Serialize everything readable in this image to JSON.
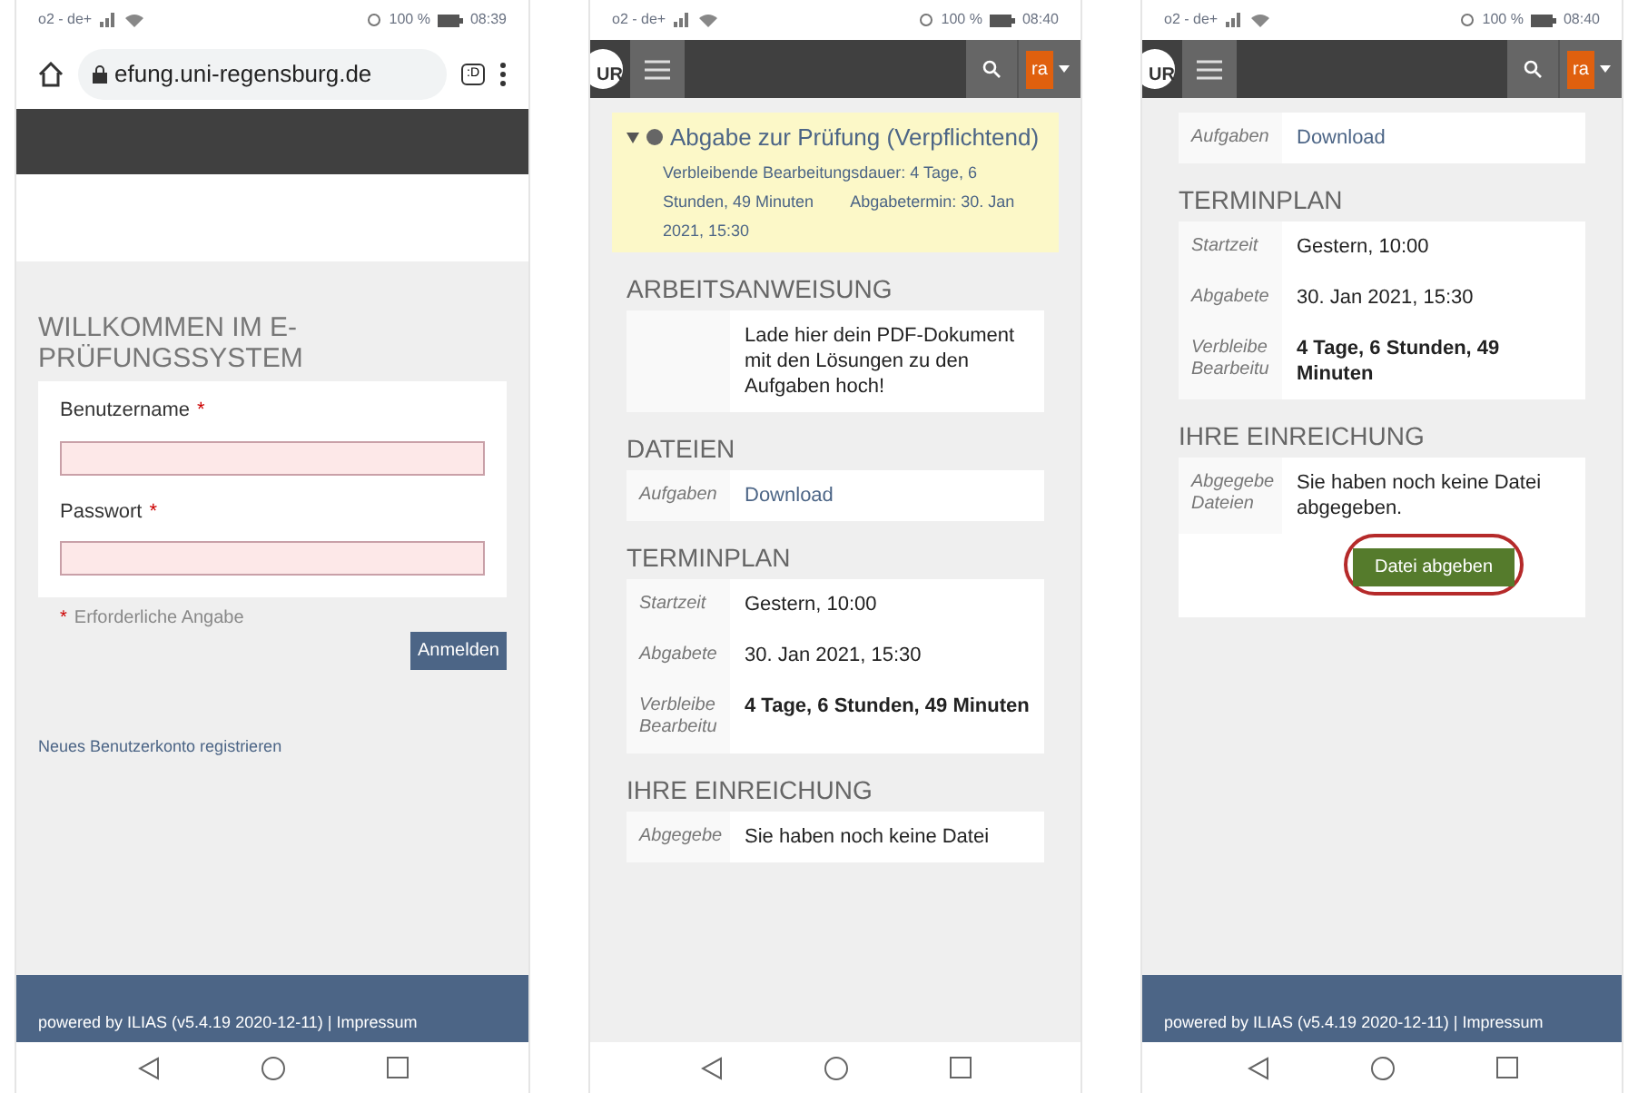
{
  "phones": [
    {
      "kind": "login",
      "status": {
        "carrier": "o2 - de+",
        "battery": "100 %",
        "time": "08:39"
      },
      "browser": {
        "url": "efung.uni-regensburg.de",
        "tab_switcher": ":D"
      },
      "login": {
        "title": "WILLKOMMEN IM E-PRÜFUNGSSYSTEM",
        "fields": [
          {
            "label": "Benutzername",
            "required_mark": "*"
          },
          {
            "label": "Passwort",
            "required_mark": "*"
          }
        ],
        "required_note": {
          "mark": "*",
          "text": "Erforderliche Angabe"
        },
        "submit": "Anmelden",
        "register_link": "Neues Benutzerkonto registrieren"
      },
      "footer": "powered by ILIAS (v5.4.19 2020-12-11) | Impressum"
    },
    {
      "kind": "exercise",
      "status": {
        "carrier": "o2 - de+",
        "battery": "100 %",
        "time": "08:40"
      },
      "header": {
        "logo": "UR",
        "avatar": "ra"
      },
      "notice": {
        "expanded": true,
        "title": "Abgabe zur Prüfung (Verpflichtend)",
        "line_1": "Verbleibende Bearbeitungsdauer: 4 Tage, 6 Stunden, 49 Minuten",
        "line_2": "Abgabetermin: 30. Jan 2021, 15:30"
      },
      "sections": [
        {
          "heading": "ARBEITSANWEISUNG",
          "rows": [
            {
              "label": "",
              "value": "Lade hier dein PDF-Dokument mit den Lösungen zu den Aufgaben hoch!",
              "kind": "text"
            }
          ]
        },
        {
          "heading": "DATEIEN",
          "rows": [
            {
              "label": "Aufgaben",
              "value": "Download",
              "kind": "link"
            }
          ]
        },
        {
          "heading": "TERMINPLAN",
          "rows": [
            {
              "label": "Startzeit",
              "value": "Gestern, 10:00",
              "kind": "text"
            },
            {
              "label": "Abgabete",
              "value": "30. Jan 2021, 15:30",
              "kind": "text"
            },
            {
              "label": "Verbleibe Bearbeitu",
              "value": "4 Tage, 6 Stunden, 49 Minuten",
              "kind": "bold"
            }
          ]
        },
        {
          "heading": "IHRE EINREICHUNG",
          "rows": [
            {
              "label": "Abgegebe",
              "value": "Sie haben noch keine Datei",
              "kind": "text"
            }
          ]
        }
      ]
    },
    {
      "kind": "exercise",
      "status": {
        "carrier": "o2 - de+",
        "battery": "100 %",
        "time": "08:40"
      },
      "header": {
        "logo": "UR",
        "avatar": "ra"
      },
      "sections": [
        {
          "rows": [
            {
              "label": "Aufgaben",
              "value": "Download",
              "kind": "link"
            }
          ]
        },
        {
          "heading": "TERMINPLAN",
          "rows": [
            {
              "label": "Startzeit",
              "value": "Gestern, 10:00",
              "kind": "text"
            },
            {
              "label": "Abgabete",
              "value": "30. Jan 2021, 15:30",
              "kind": "text"
            },
            {
              "label": "Verbleibe Bearbeitu",
              "value": "4 Tage, 6 Stunden, 49 Minuten",
              "kind": "bold"
            }
          ]
        },
        {
          "heading": "IHRE EINREICHUNG",
          "rows": [
            {
              "label": "Abgegebe Dateien",
              "value": "Sie haben noch keine Datei abgegeben.",
              "kind": "text"
            }
          ],
          "button": {
            "label": "Datei abgeben",
            "highlighted": true
          }
        }
      ],
      "footer": "powered by ILIAS (v5.4.19 2020-12-11) | Impressum"
    }
  ]
}
